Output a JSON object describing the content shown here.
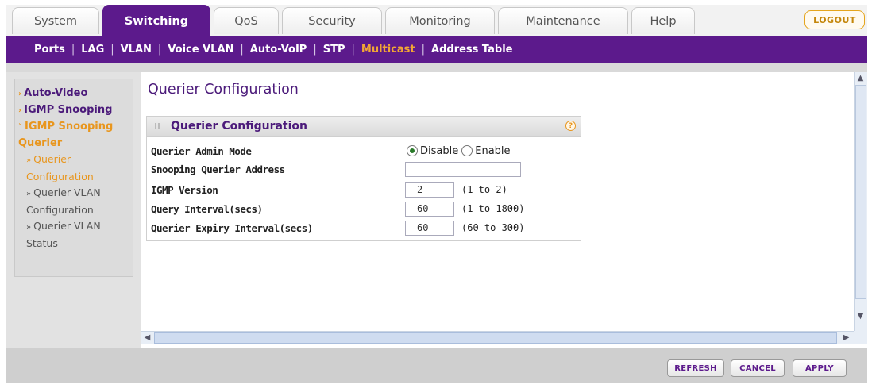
{
  "top_tabs": [
    "System",
    "Switching",
    "QoS",
    "Security",
    "Monitoring",
    "Maintenance",
    "Help"
  ],
  "active_tab": "Switching",
  "logout_label": "LOGOUT",
  "subnav": [
    "Ports",
    "LAG",
    "VLAN",
    "Voice VLAN",
    "Auto-VoIP",
    "STP",
    "Multicast",
    "Address Table"
  ],
  "active_subnav": "Multicast",
  "sidebar": {
    "items": [
      {
        "label": "Auto-Video"
      },
      {
        "label": "IGMP Snooping"
      },
      {
        "label": "IGMP Snooping Querier",
        "line1": "IGMP Snooping",
        "line2": "Querier"
      }
    ],
    "subitems": [
      {
        "line1": "Querier",
        "line2": "Configuration"
      },
      {
        "line1": "Querier VLAN",
        "line2": "Configuration"
      },
      {
        "line1": "Querier VLAN",
        "line2": "Status"
      }
    ]
  },
  "page_title": "Querier Configuration",
  "panel": {
    "title": "Querier Configuration",
    "help_icon": "?",
    "rows": {
      "admin_mode": {
        "label": "Querier Admin Mode",
        "options": [
          "Disable",
          "Enable"
        ],
        "selected": "Disable"
      },
      "address": {
        "label": "Snooping Querier Address",
        "value": ""
      },
      "version": {
        "label": "IGMP Version",
        "value": "2",
        "range": "(1 to 2)"
      },
      "query_interval": {
        "label": "Query Interval(secs)",
        "value": "60",
        "range": "(1 to 1800)"
      },
      "expiry_interval": {
        "label": "Querier Expiry Interval(secs)",
        "value": "60",
        "range": "(60 to 300)"
      }
    }
  },
  "buttons": {
    "refresh": "REFRESH",
    "cancel": "CANCEL",
    "apply": "APPLY"
  },
  "colors": {
    "brand_purple": "#5c1a8c",
    "accent_orange": "#e8961e"
  }
}
